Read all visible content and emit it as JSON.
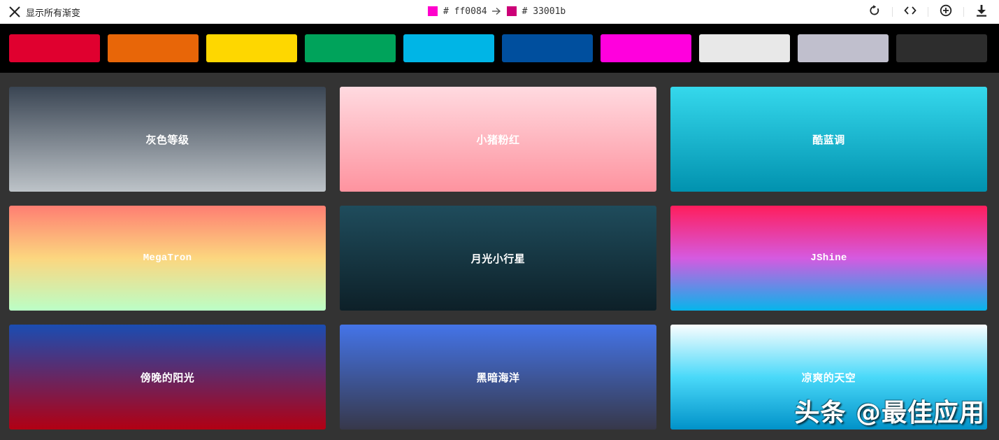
{
  "header": {
    "close_label": "显示所有渐变",
    "current": {
      "from_color": "#ff00cc",
      "from_hex": "# ff0084",
      "to_color": "#cc0077",
      "to_hex": "# 33001b"
    },
    "tools": [
      {
        "icon": "rotate-icon"
      },
      {
        "icon": "code-icon"
      },
      {
        "icon": "add-circle-icon"
      },
      {
        "icon": "download-icon"
      }
    ]
  },
  "color_filters": [
    {
      "color": "#e0002f"
    },
    {
      "color": "#e86608"
    },
    {
      "color": "#fed700"
    },
    {
      "color": "#00a35b"
    },
    {
      "color": "#00b5e6"
    },
    {
      "color": "#004f9e"
    },
    {
      "color": "#ff00dd"
    },
    {
      "color": "#e8e8e8"
    },
    {
      "color": "#c0bfcd"
    },
    {
      "color": "#2d2d2d"
    }
  ],
  "gradients": [
    {
      "name": "灰色等级",
      "from": "#3a4553",
      "to": "#bdc3c8",
      "mono": false
    },
    {
      "name": "小猪粉红",
      "from": "#ffdae0",
      "to": "#fe939f",
      "mono": false
    },
    {
      "name": "酷蓝调",
      "from": "#35d8ec",
      "to": "#0192af",
      "mono": false
    },
    {
      "name": "MegaTron",
      "from": "#fe7e72",
      "middle": "#fcd67f",
      "to": "#bbfec6",
      "mono": true
    },
    {
      "name": "月光小行星",
      "from": "#1f4c5c",
      "to": "#0d2028",
      "mono": false
    },
    {
      "name": "JShine",
      "from": "#ff1d5c",
      "middle": "#d55ae0",
      "to": "#06b5eb",
      "mono": true
    },
    {
      "name": "傍晚的阳光",
      "from": "#1a4db2",
      "to": "#b20013",
      "mono": false
    },
    {
      "name": "黑暗海洋",
      "from": "#4474e8",
      "to": "#37384a",
      "mono": false
    },
    {
      "name": "凉爽的天空",
      "from": "#fafdfe",
      "middle": "#4ad9f9",
      "to": "#0192c9",
      "mono": false
    }
  ],
  "watermark": "头条 @最佳应用"
}
